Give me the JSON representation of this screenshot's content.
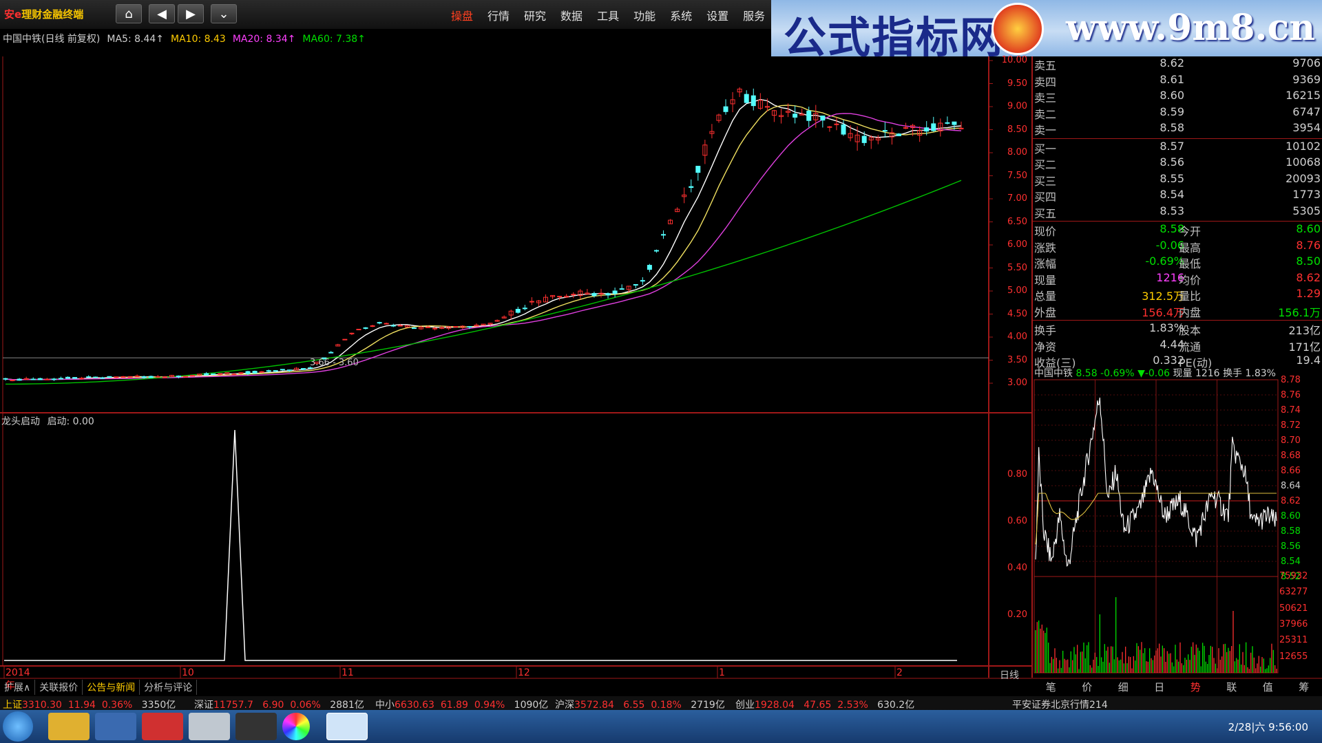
{
  "app": {
    "title_prefix": "安e",
    "title_rest": "理财金融终端"
  },
  "nav": {
    "home": "⌂",
    "back": "◀",
    "forward": "▶",
    "more": "⌄"
  },
  "menu": [
    "操盘",
    "行情",
    "研究",
    "数据",
    "工具",
    "功能",
    "系统",
    "设置",
    "服务"
  ],
  "menu_active": 0,
  "banner": {
    "left": "公式指标网",
    "right": "www.9m8.cn"
  },
  "chart_header": {
    "stock": "中国中铁(日线 前复权)",
    "ma5": "MA5: 8.44↑",
    "ma10": "MA10: 8.43",
    "ma20": "MA20: 8.34↑",
    "ma60": "MA60: 7.38↑"
  },
  "indicator_header": {
    "name": "龙头启动",
    "value": "启动: 0.00"
  },
  "support_line_label": "3.66 - 3.60",
  "price_axis": [
    "10.00",
    "9.50",
    "9.00",
    "8.50",
    "8.00",
    "7.50",
    "7.00",
    "6.50",
    "6.00",
    "5.50",
    "5.00",
    "4.50",
    "4.00",
    "3.50",
    "3.00"
  ],
  "indicator_axis": [
    "0.80",
    "0.60",
    "0.40",
    "0.20"
  ],
  "time_axis": [
    "2014年",
    "10",
    "11",
    "12",
    "1",
    "2"
  ],
  "period_label": "日线",
  "quote": {
    "asks": [
      {
        "label": "卖五",
        "price": "8.62",
        "vol": "9706"
      },
      {
        "label": "卖四",
        "price": "8.61",
        "vol": "9369"
      },
      {
        "label": "卖三",
        "price": "8.60",
        "vol": "16215"
      },
      {
        "label": "卖二",
        "price": "8.59",
        "vol": "6747"
      },
      {
        "label": "卖一",
        "price": "8.58",
        "vol": "3954"
      }
    ],
    "bids": [
      {
        "label": "买一",
        "price": "8.57",
        "vol": "10102"
      },
      {
        "label": "买二",
        "price": "8.56",
        "vol": "10068"
      },
      {
        "label": "买三",
        "price": "8.55",
        "vol": "20093"
      },
      {
        "label": "买四",
        "price": "8.54",
        "vol": "1773"
      },
      {
        "label": "买五",
        "price": "8.53",
        "vol": "5305"
      }
    ],
    "stats": [
      {
        "l1": "现价",
        "v1": "8.58",
        "l2": "今开",
        "v2": "8.60"
      },
      {
        "l1": "涨跌",
        "v1": "-0.06",
        "l2": "最高",
        "v2": "8.76"
      },
      {
        "l1": "涨幅",
        "v1": "-0.69%",
        "l2": "最低",
        "v2": "8.50"
      },
      {
        "l1": "现量",
        "v1": "1216",
        "l2": "均价",
        "v2": "8.62"
      },
      {
        "l1": "总量",
        "v1": "312.5万",
        "l2": "量比",
        "v2": "1.29"
      },
      {
        "l1": "外盘",
        "v1": "156.4万",
        "l2": "内盘",
        "v2": "156.1万"
      }
    ],
    "stats2": [
      {
        "l1": "换手",
        "v1": "1.83%",
        "l2": "股本",
        "v2": "213亿"
      },
      {
        "l1": "净资",
        "v1": "4.44",
        "l2": "流通",
        "v2": "171亿"
      },
      {
        "l1": "收益(三)",
        "v1": "0.332",
        "l2": "PE(动)",
        "v2": "19.4"
      }
    ]
  },
  "intraday_header": {
    "stock": "中国中铁",
    "price": "8.58",
    "pct": "-0.69%",
    "chg": "▼-0.06",
    "vol": "现量 1216",
    "turnover": "换手 1.83%"
  },
  "intraday_price_axis": [
    "8.78",
    "8.76",
    "8.74",
    "8.72",
    "8.70",
    "8.68",
    "8.66",
    "8.64",
    "8.62",
    "8.60",
    "8.58",
    "8.56",
    "8.54",
    "8.52"
  ],
  "intraday_vol_axis": [
    "75932",
    "63277",
    "50621",
    "37966",
    "25311",
    "12655"
  ],
  "bottom_tabs": [
    "扩展∧",
    "关联报价",
    "公告与新闻",
    "分析与评论"
  ],
  "bottom_tab_active": 2,
  "right_tabs": [
    "笔",
    "价",
    "细",
    "日",
    "势",
    "联",
    "值",
    "筹"
  ],
  "right_tab_active": 4,
  "status": {
    "sh_label": "上证",
    "sh_val": "3310.30",
    "sh_chg": "11.94",
    "sh_pct": "0.36%",
    "sh_amt": "3350亿",
    "sz_label": "深证",
    "sz_val": "11757.7",
    "sz_chg": "6.90",
    "sz_pct": "0.06%",
    "sz_amt": "2881亿",
    "zx_label": "中小",
    "zx_val": "6630.63",
    "zx_chg": "61.89",
    "zx_pct": "0.94%",
    "zx_amt": "1090亿",
    "hs_label": "沪深",
    "hs_val": "3572.84",
    "hs_chg": "6.55",
    "hs_pct": "0.18%",
    "hs_amt": "2719亿",
    "cy_label": "创业",
    "cy_val": "1928.04",
    "cy_chg": "47.65",
    "cy_pct": "2.53%",
    "cy_amt": "630.2亿",
    "broker": "平安证券北京行情214"
  },
  "taskbar": {
    "clock": "2/28|六 9:56:00"
  },
  "colors": {
    "up": "#ff3030",
    "down": "#00e000",
    "cyan": "#54ffff",
    "ma5": "#ffffff",
    "ma10": "#f0e060",
    "ma20": "#e040e0",
    "ma60": "#00c000",
    "grid": "#a01818"
  }
}
